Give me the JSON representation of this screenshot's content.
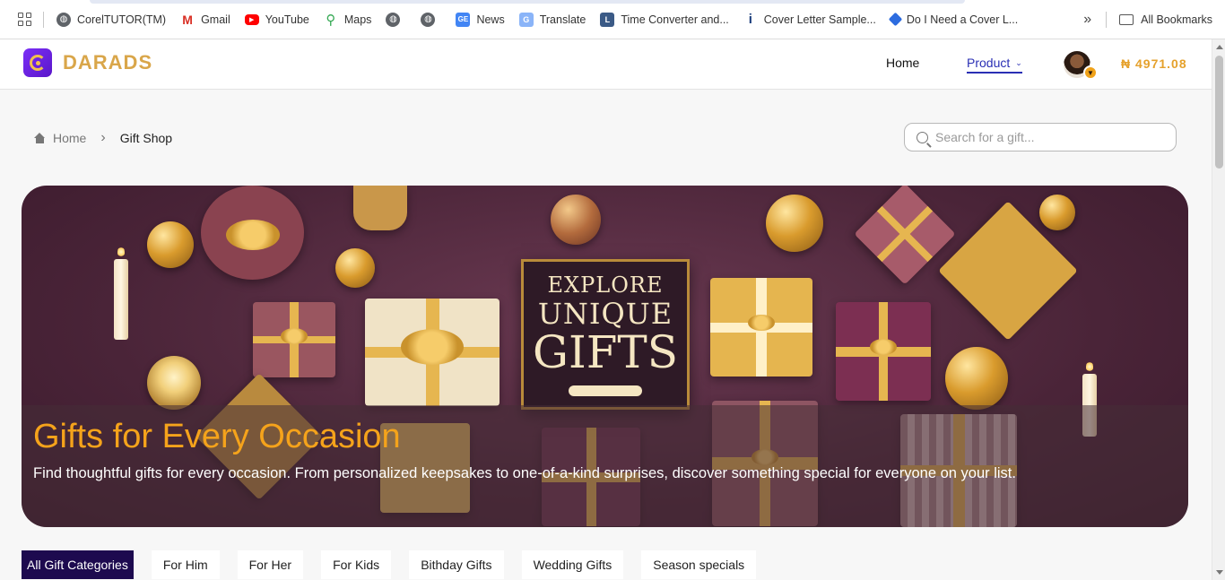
{
  "bookmarks_bar": {
    "items": [
      {
        "label": "CorelTUTOR(TM)",
        "icon": "globe-icon"
      },
      {
        "label": "Gmail",
        "icon": "gmail-icon"
      },
      {
        "label": "YouTube",
        "icon": "youtube-icon"
      },
      {
        "label": "Maps",
        "icon": "maps-pin-icon"
      },
      {
        "label": "",
        "icon": "globe-icon"
      },
      {
        "label": "",
        "icon": "globe-icon"
      },
      {
        "label": "News",
        "icon": "google-news-icon"
      },
      {
        "label": "Translate",
        "icon": "google-translate-icon"
      },
      {
        "label": "Time Converter and...",
        "icon": "time-converter-icon"
      },
      {
        "label": "Cover Letter Sample...",
        "icon": "info-icon"
      },
      {
        "label": "Do I Need a Cover L...",
        "icon": "bookmark-site-icon"
      }
    ],
    "more_glyph": "»",
    "all_bookmarks_label": "All Bookmarks"
  },
  "header": {
    "logo_text": "DARADS",
    "nav": {
      "home_label": "Home",
      "product_label": "Product"
    },
    "balance": "₦ 4971.08"
  },
  "breadcrumb": {
    "home_label": "Home",
    "current_label": "Gift Shop"
  },
  "search": {
    "placeholder": "Search for a gift...",
    "value": ""
  },
  "hero": {
    "sign_line1": "EXPLORE",
    "sign_line2": "UNIQUE",
    "sign_line3": "GIFTS",
    "title": "Gifts for Every Occasion",
    "description": "Find thoughtful gifts for every occasion. From personalized keepsakes to one-of-a-kind surprises, discover something special for everyone on your list."
  },
  "categories": [
    {
      "label": "All Gift Categories",
      "active": true
    },
    {
      "label": "For Him",
      "active": false
    },
    {
      "label": "For Her",
      "active": false
    },
    {
      "label": "For Kids",
      "active": false
    },
    {
      "label": "Bithday Gifts",
      "active": false
    },
    {
      "label": "Wedding Gifts",
      "active": false
    },
    {
      "label": "Season specials",
      "active": false
    }
  ],
  "colors": {
    "accent_gold": "#e5a12c",
    "nav_active": "#2a2fb4",
    "hero_title": "#f5a31b",
    "active_tab_bg": "#1d0a4f",
    "logo_purple": "#7b2ff7"
  }
}
